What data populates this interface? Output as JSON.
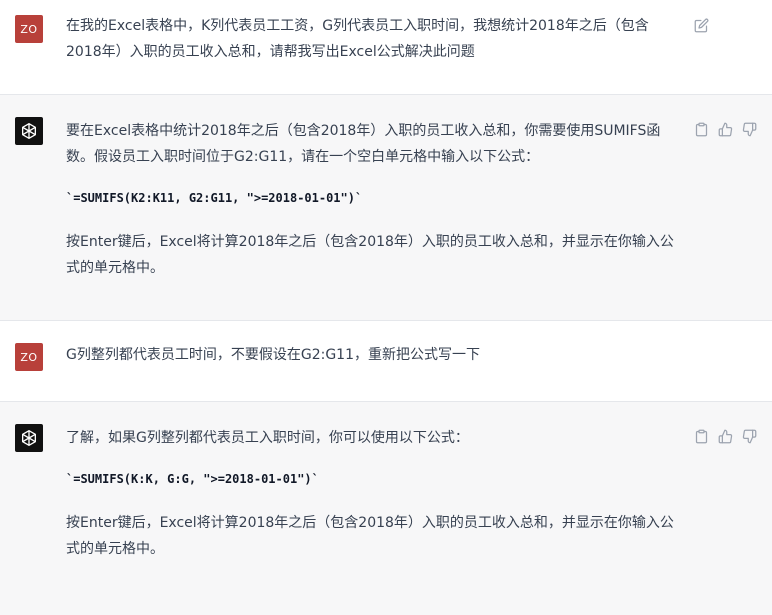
{
  "conversation": [
    {
      "role": "user",
      "avatar_text": "ZO",
      "paragraphs": [
        "在我的Excel表格中，K列代表员工工资，G列代表员工入职时间，我想统计2018年之后（包含2018年）入职的员工收入总和，请帮我写出Excel公式解决此问题"
      ]
    },
    {
      "role": "assistant",
      "paragraphs": [
        "要在Excel表格中统计2018年之后（包含2018年）入职的员工收入总和，你需要使用SUMIFS函数。假设员工入职时间位于G2:G11，请在一个空白单元格中输入以下公式：",
        "`=SUMIFS(K2:K11, G2:G11, \">=2018-01-01\")`",
        "按Enter键后，Excel将计算2018年之后（包含2018年）入职的员工收入总和，并显示在你输入公式的单元格中。"
      ]
    },
    {
      "role": "user",
      "avatar_text": "ZO",
      "paragraphs": [
        "G列整列都代表员工时间，不要假设在G2:G11，重新把公式写一下"
      ]
    },
    {
      "role": "assistant",
      "paragraphs": [
        "了解，如果G列整列都代表员工入职时间，你可以使用以下公式：",
        "`=SUMIFS(K:K, G:G, \">=2018-01-01\")`",
        "按Enter键后，Excel将计算2018年之后（包含2018年）入职的员工收入总和，并显示在你输入公式的单元格中。"
      ]
    }
  ],
  "icons": {
    "edit": "edit-icon",
    "copy": "copy-icon",
    "thumbs_up": "thumbs-up-icon",
    "thumbs_down": "thumbs-down-icon",
    "assistant_logo": "openai-logo-icon"
  },
  "colors": {
    "user_avatar_bg": "#b8403a",
    "assistant_avatar_bg": "#111111",
    "assistant_row_bg": "#f7f7f8",
    "text": "#374151",
    "icon": "#9ca3af"
  }
}
